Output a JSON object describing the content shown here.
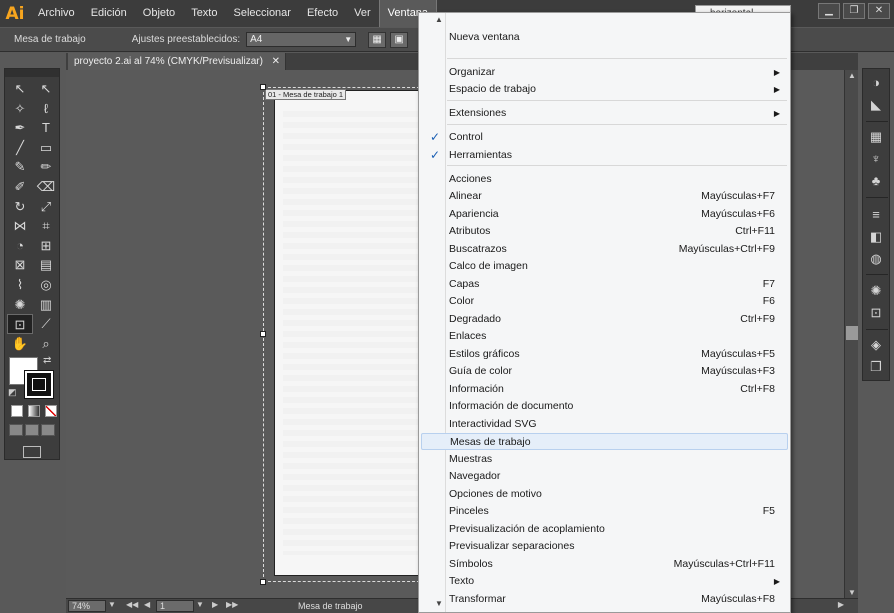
{
  "app": {
    "logo": "Ai"
  },
  "menubar": {
    "items": [
      "Archivo",
      "Edición",
      "Objeto",
      "Texto",
      "Seleccionar",
      "Efecto",
      "Ver",
      "Ventana"
    ],
    "active": "Ventana",
    "search_value": "horizontal"
  },
  "window_controls": {
    "minimize": "▁",
    "restore": "❐",
    "close": "✕"
  },
  "controlbar": {
    "label": "Mesa de trabajo",
    "preset_label": "Ajustes preestablecidos:",
    "preset_value": "A4",
    "icon_1": "▦",
    "icon_2": "▣",
    "icon_3": "▪"
  },
  "document_tab": {
    "title": "proyecto 2.ai al 74% (CMYK/Previsualizar)",
    "close": "✕"
  },
  "artboard": {
    "label": "01 - Mesa de trabajo 1"
  },
  "tools": [
    {
      "name": "selection-tool",
      "glyph": "↖"
    },
    {
      "name": "direct-selection-tool",
      "glyph": "↖"
    },
    {
      "name": "magic-wand-tool",
      "glyph": "✧"
    },
    {
      "name": "lasso-tool",
      "glyph": "ℓ"
    },
    {
      "name": "pen-tool",
      "glyph": "✒"
    },
    {
      "name": "type-tool",
      "glyph": "T"
    },
    {
      "name": "line-tool",
      "glyph": "╱"
    },
    {
      "name": "rectangle-tool",
      "glyph": "▭"
    },
    {
      "name": "paintbrush-tool",
      "glyph": "✎"
    },
    {
      "name": "pencil-tool",
      "glyph": "✏"
    },
    {
      "name": "blob-brush-tool",
      "glyph": "✐"
    },
    {
      "name": "eraser-tool",
      "glyph": "⌫"
    },
    {
      "name": "rotate-tool",
      "glyph": "↻"
    },
    {
      "name": "scale-tool",
      "glyph": "⤢"
    },
    {
      "name": "width-tool",
      "glyph": "⋈"
    },
    {
      "name": "free-transform-tool",
      "glyph": "⌗"
    },
    {
      "name": "shape-builder-tool",
      "glyph": "◔"
    },
    {
      "name": "perspective-grid-tool",
      "glyph": "⊞"
    },
    {
      "name": "mesh-tool",
      "glyph": "⊠"
    },
    {
      "name": "gradient-tool",
      "glyph": "▤"
    },
    {
      "name": "eyedropper-tool",
      "glyph": "⌇"
    },
    {
      "name": "blend-tool",
      "glyph": "◎"
    },
    {
      "name": "symbol-sprayer-tool",
      "glyph": "✺"
    },
    {
      "name": "column-graph-tool",
      "glyph": "▥"
    },
    {
      "name": "artboard-tool",
      "glyph": "⊡"
    },
    {
      "name": "slice-tool",
      "glyph": "⟋"
    },
    {
      "name": "hand-tool",
      "glyph": "✋"
    },
    {
      "name": "zoom-tool",
      "glyph": "⌕"
    }
  ],
  "dropdown": {
    "rows": [
      {
        "label": "Nueva ventana",
        "shortcut": "",
        "submenu": false,
        "checked": false,
        "highlighted": false
      },
      {
        "label": "Organizar",
        "shortcut": "",
        "submenu": true,
        "checked": false,
        "highlighted": false
      },
      {
        "label": "Espacio de trabajo",
        "shortcut": "",
        "submenu": true,
        "checked": false,
        "highlighted": false
      },
      {
        "label": "Extensiones",
        "shortcut": "",
        "submenu": true,
        "checked": false,
        "highlighted": false
      },
      {
        "label": "Control",
        "shortcut": "",
        "submenu": false,
        "checked": true,
        "highlighted": false
      },
      {
        "label": "Herramientas",
        "shortcut": "",
        "submenu": false,
        "checked": true,
        "highlighted": false
      },
      {
        "label": "Acciones",
        "shortcut": "",
        "submenu": false,
        "checked": false,
        "highlighted": false
      },
      {
        "label": "Alinear",
        "shortcut": "Mayúsculas+F7",
        "submenu": false,
        "checked": false,
        "highlighted": false
      },
      {
        "label": "Apariencia",
        "shortcut": "Mayúsculas+F6",
        "submenu": false,
        "checked": false,
        "highlighted": false
      },
      {
        "label": "Atributos",
        "shortcut": "Ctrl+F11",
        "submenu": false,
        "checked": false,
        "highlighted": false
      },
      {
        "label": "Buscatrazos",
        "shortcut": "Mayúsculas+Ctrl+F9",
        "submenu": false,
        "checked": false,
        "highlighted": false
      },
      {
        "label": "Calco de imagen",
        "shortcut": "",
        "submenu": false,
        "checked": false,
        "highlighted": false
      },
      {
        "label": "Capas",
        "shortcut": "F7",
        "submenu": false,
        "checked": false,
        "highlighted": false
      },
      {
        "label": "Color",
        "shortcut": "F6",
        "submenu": false,
        "checked": false,
        "highlighted": false
      },
      {
        "label": "Degradado",
        "shortcut": "Ctrl+F9",
        "submenu": false,
        "checked": false,
        "highlighted": false
      },
      {
        "label": "Enlaces",
        "shortcut": "",
        "submenu": false,
        "checked": false,
        "highlighted": false
      },
      {
        "label": "Estilos gráficos",
        "shortcut": "Mayúsculas+F5",
        "submenu": false,
        "checked": false,
        "highlighted": false
      },
      {
        "label": "Guía de color",
        "shortcut": "Mayúsculas+F3",
        "submenu": false,
        "checked": false,
        "highlighted": false
      },
      {
        "label": "Información",
        "shortcut": "Ctrl+F8",
        "submenu": false,
        "checked": false,
        "highlighted": false
      },
      {
        "label": "Información de documento",
        "shortcut": "",
        "submenu": false,
        "checked": false,
        "highlighted": false
      },
      {
        "label": "Interactividad SVG",
        "shortcut": "",
        "submenu": false,
        "checked": false,
        "highlighted": false
      },
      {
        "label": "Mesas de trabajo",
        "shortcut": "",
        "submenu": false,
        "checked": false,
        "highlighted": true
      },
      {
        "label": "Muestras",
        "shortcut": "",
        "submenu": false,
        "checked": false,
        "highlighted": false
      },
      {
        "label": "Navegador",
        "shortcut": "",
        "submenu": false,
        "checked": false,
        "highlighted": false
      },
      {
        "label": "Opciones de motivo",
        "shortcut": "",
        "submenu": false,
        "checked": false,
        "highlighted": false
      },
      {
        "label": "Pinceles",
        "shortcut": "F5",
        "submenu": false,
        "checked": false,
        "highlighted": false
      },
      {
        "label": "Previsualización de acoplamiento",
        "shortcut": "",
        "submenu": false,
        "checked": false,
        "highlighted": false
      },
      {
        "label": "Previsualizar separaciones",
        "shortcut": "",
        "submenu": false,
        "checked": false,
        "highlighted": false
      },
      {
        "label": "Símbolos",
        "shortcut": "Mayúsculas+Ctrl+F11",
        "submenu": false,
        "checked": false,
        "highlighted": false
      },
      {
        "label": "Texto",
        "shortcut": "",
        "submenu": true,
        "checked": false,
        "highlighted": false
      },
      {
        "label": "Transformar",
        "shortcut": "Mayúsculas+F8",
        "submenu": false,
        "checked": false,
        "highlighted": false
      }
    ]
  },
  "dock_icons": [
    "color-guide-icon",
    "gradient-panel-icon",
    "swatches-icon",
    "brushes-icon",
    "symbols-icon",
    "stroke-icon",
    "transparency-icon",
    "appearance-icon",
    "graphic-styles-icon",
    "artboards-icon",
    "layers-icon",
    "links-icon"
  ],
  "statusbar": {
    "zoom": "74%",
    "artboard_number": "1",
    "status": "Mesa de trabajo"
  },
  "colors": {
    "accent_logo": "#f7a51e",
    "menu_highlight": "#e5eef9",
    "check": "#1a5fb4"
  }
}
